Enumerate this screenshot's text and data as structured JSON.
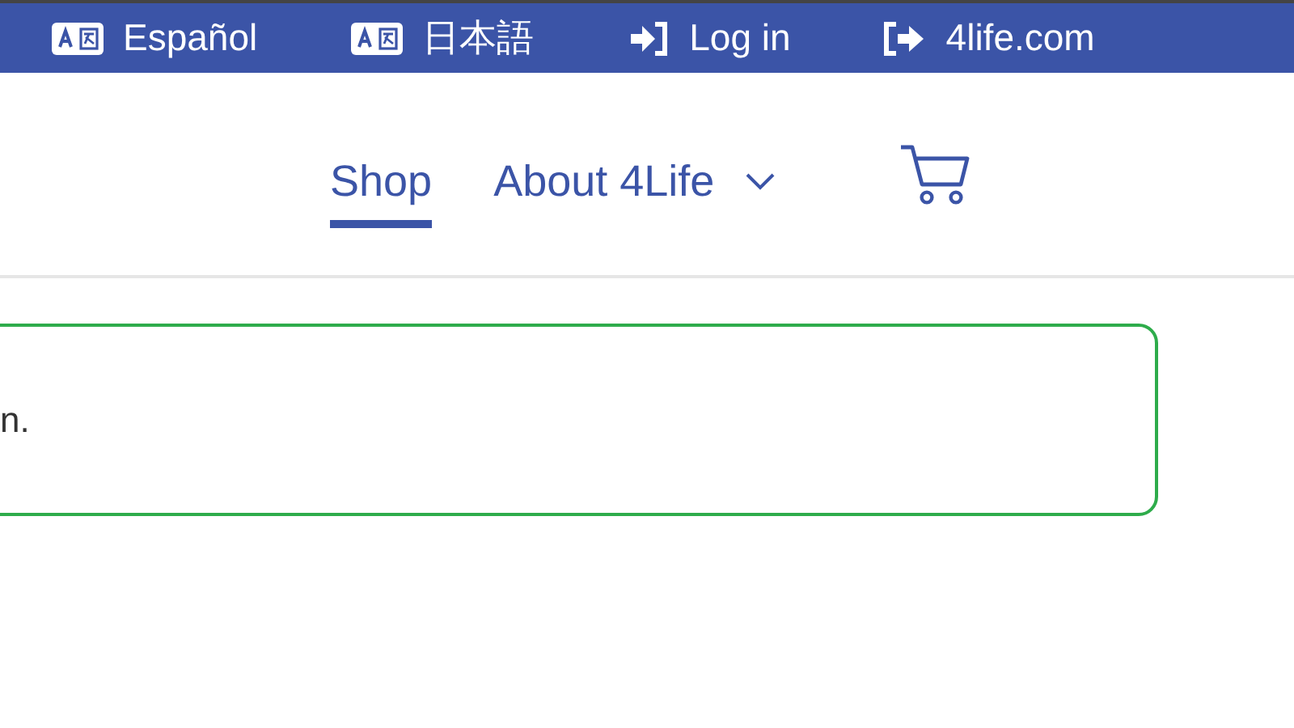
{
  "top_bar": [
    {
      "kind": "language",
      "label": "Español"
    },
    {
      "kind": "language",
      "label": "日本語"
    },
    {
      "kind": "login",
      "label": "Log in"
    },
    {
      "kind": "external",
      "label": "4life.com"
    }
  ],
  "nav": [
    {
      "label": "Shop",
      "selected": true,
      "dropdown": false
    },
    {
      "label": "About 4Life",
      "selected": false,
      "dropdown": true
    }
  ],
  "alert": {
    "text": "n."
  }
}
